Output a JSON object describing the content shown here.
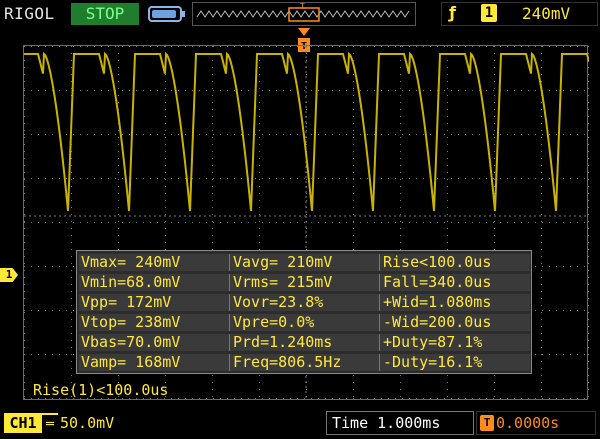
{
  "topbar": {
    "brand": "RIGOL",
    "run_state": "STOP",
    "trigger_edge_icon": "rising-edge-icon",
    "trigger_source": "1",
    "trigger_level": "240mV"
  },
  "markers": {
    "ch1_marker_label": "1",
    "trigger_position_marker": "T"
  },
  "measurements": {
    "rows": [
      [
        "Vmax= 240mV",
        "Vavg= 210mV",
        "Rise<100.0us"
      ],
      [
        "Vmin=68.0mV",
        "Vrms= 215mV",
        "Fall=340.0us"
      ],
      [
        "Vpp= 172mV",
        "Vovr=23.8%",
        "+Wid=1.080ms"
      ],
      [
        "Vtop= 238mV",
        "Vpre=0.0%",
        "-Wid=200.0us"
      ],
      [
        "Vbas=70.0mV",
        "Prd=1.240ms",
        "+Duty=87.1%"
      ],
      [
        "Vamp= 168mV",
        "Freq=806.5Hz",
        "-Duty=16.1%"
      ]
    ]
  },
  "hint": "Rise(1)<100.0us",
  "bottombar": {
    "channel_label": "CH1",
    "channel_scale": "50.0mV",
    "time_label": "Time 1.000ms",
    "trigger_position_icon": "T",
    "trigger_position_value": "0.0000s"
  },
  "colors": {
    "trace": "#c8b400",
    "ch1": "#ffe83a",
    "run_state_bg": "#1f7d2d",
    "trigger_pos": "#ff8a1e"
  }
}
